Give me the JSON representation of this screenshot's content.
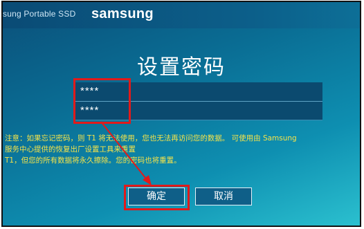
{
  "header": {
    "product_name": "sung Portable SSD",
    "brand": "samsung"
  },
  "dialog": {
    "title": "设置密码",
    "password_field_1": "****",
    "password_field_2": "****",
    "notice_lines": [
      "注意：如果忘记密码，则 T1 将无法使用，您也无法再访问您的数据。 可使用由 Samsung",
      "服务中心提供的恢复出厂设置工具来重置",
      "T1，但您的所有数据将永久擦除。您的密码也将重置。"
    ],
    "ok_label": "确定",
    "cancel_label": "取消"
  },
  "colors": {
    "highlight": "#e21a1a",
    "notice_text": "#f5e34a",
    "background_top": "#0b4f79",
    "background_bottom": "#2bc0cf"
  }
}
